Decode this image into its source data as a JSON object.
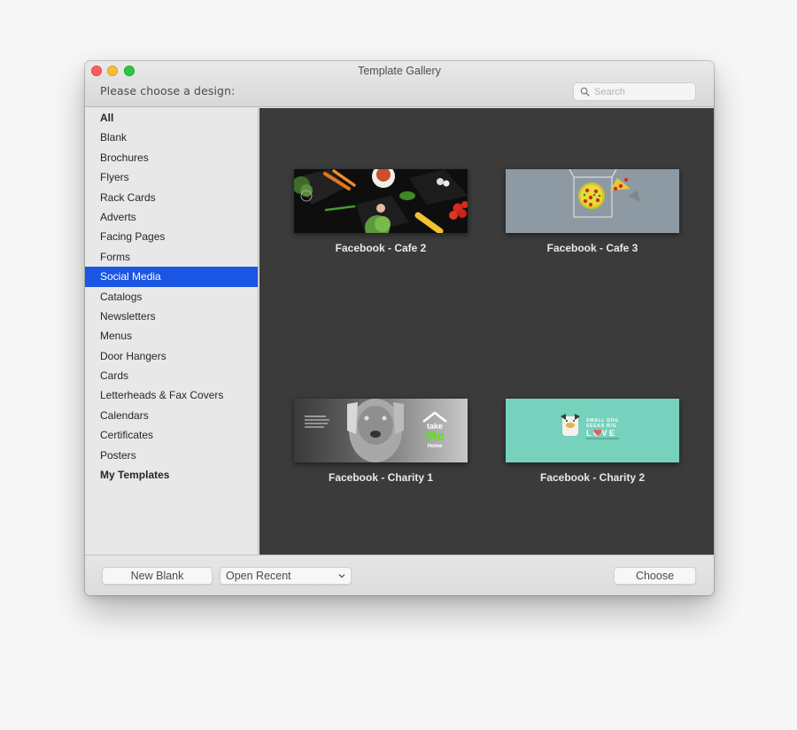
{
  "window": {
    "title": "Template Gallery",
    "prompt": "Please choose a design:"
  },
  "search": {
    "placeholder": "Search",
    "value": "",
    "icon": "search-icon"
  },
  "sidebar": {
    "items": [
      {
        "label": "All",
        "bold": true,
        "selected": false
      },
      {
        "label": "Blank",
        "bold": false,
        "selected": false
      },
      {
        "label": "Brochures",
        "bold": false,
        "selected": false
      },
      {
        "label": "Flyers",
        "bold": false,
        "selected": false
      },
      {
        "label": "Rack Cards",
        "bold": false,
        "selected": false
      },
      {
        "label": "Adverts",
        "bold": false,
        "selected": false
      },
      {
        "label": "Facing Pages",
        "bold": false,
        "selected": false
      },
      {
        "label": "Forms",
        "bold": false,
        "selected": false
      },
      {
        "label": "Social Media",
        "bold": false,
        "selected": true
      },
      {
        "label": "Catalogs",
        "bold": false,
        "selected": false
      },
      {
        "label": "Newsletters",
        "bold": false,
        "selected": false
      },
      {
        "label": "Menus",
        "bold": false,
        "selected": false
      },
      {
        "label": "Door Hangers",
        "bold": false,
        "selected": false
      },
      {
        "label": "Cards",
        "bold": false,
        "selected": false
      },
      {
        "label": "Letterheads & Fax Covers",
        "bold": false,
        "selected": false
      },
      {
        "label": "Calendars",
        "bold": false,
        "selected": false
      },
      {
        "label": "Certificates",
        "bold": false,
        "selected": false
      },
      {
        "label": "Posters",
        "bold": false,
        "selected": false
      },
      {
        "label": "My Templates",
        "bold": true,
        "selected": false
      }
    ],
    "selected_color": "#1b55e3"
  },
  "gallery": {
    "templates": [
      {
        "label": "Facebook - Cafe 2",
        "thumb_bg": "#0d0d0d"
      },
      {
        "label": "Facebook - Cafe 3",
        "thumb_bg": "#8e9aa3"
      },
      {
        "label": "Facebook - Charity 1",
        "thumb_bg": "#7a7a7a",
        "thumb_text": [
          "take",
          "Me",
          "Home"
        ]
      },
      {
        "label": "Facebook - Charity 2",
        "thumb_bg": "#76d1bd",
        "thumb_text": [
          "SMALL DOG",
          "SEEKS BIG",
          "LOVE"
        ]
      }
    ]
  },
  "footer": {
    "new_blank_label": "New Blank",
    "open_recent_label": "Open Recent",
    "choose_label": "Choose"
  }
}
